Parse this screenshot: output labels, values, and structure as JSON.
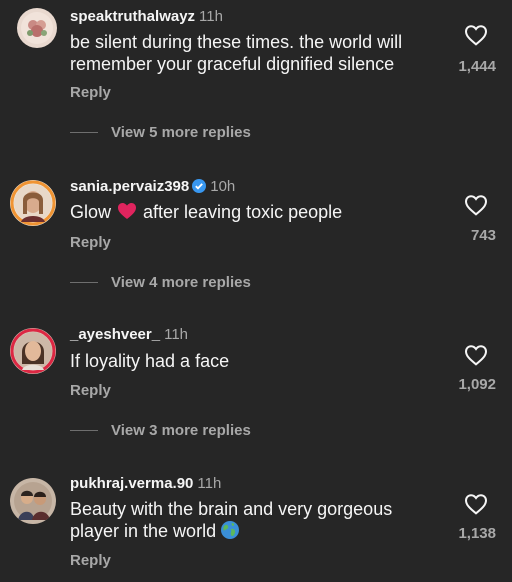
{
  "comments": [
    {
      "username": "speaktruthalwayz",
      "time": "11h",
      "text": "be silent during these times. the world will remember your graceful dignified silence",
      "likes": "1,444",
      "reply_label": "Reply",
      "view_replies": "View 5 more replies"
    },
    {
      "username": "sania.pervaiz398",
      "verified": true,
      "time": "10h",
      "text_before": "Glow",
      "text_after": "after leaving toxic people",
      "emoji": "heart",
      "likes": "743",
      "reply_label": "Reply",
      "view_replies": "View 4 more replies"
    },
    {
      "username": "_ayeshveer_",
      "time": "11h",
      "text": "If loyality had a face",
      "likes": "1,092",
      "reply_label": "Reply",
      "view_replies": "View 3 more replies"
    },
    {
      "username": "pukhraj.verma.90",
      "time": "11h",
      "text": "Beauty with the brain and very  gorgeous player in the world",
      "emoji": "globe",
      "likes": "1,138",
      "reply_label": "Reply"
    }
  ],
  "colors": {
    "background": "#262626",
    "primary_text": "#f5f5f5",
    "secondary_text": "#a8a8a8",
    "verified_badge": "#3897f0",
    "heart_emoji": "#e0245e"
  }
}
